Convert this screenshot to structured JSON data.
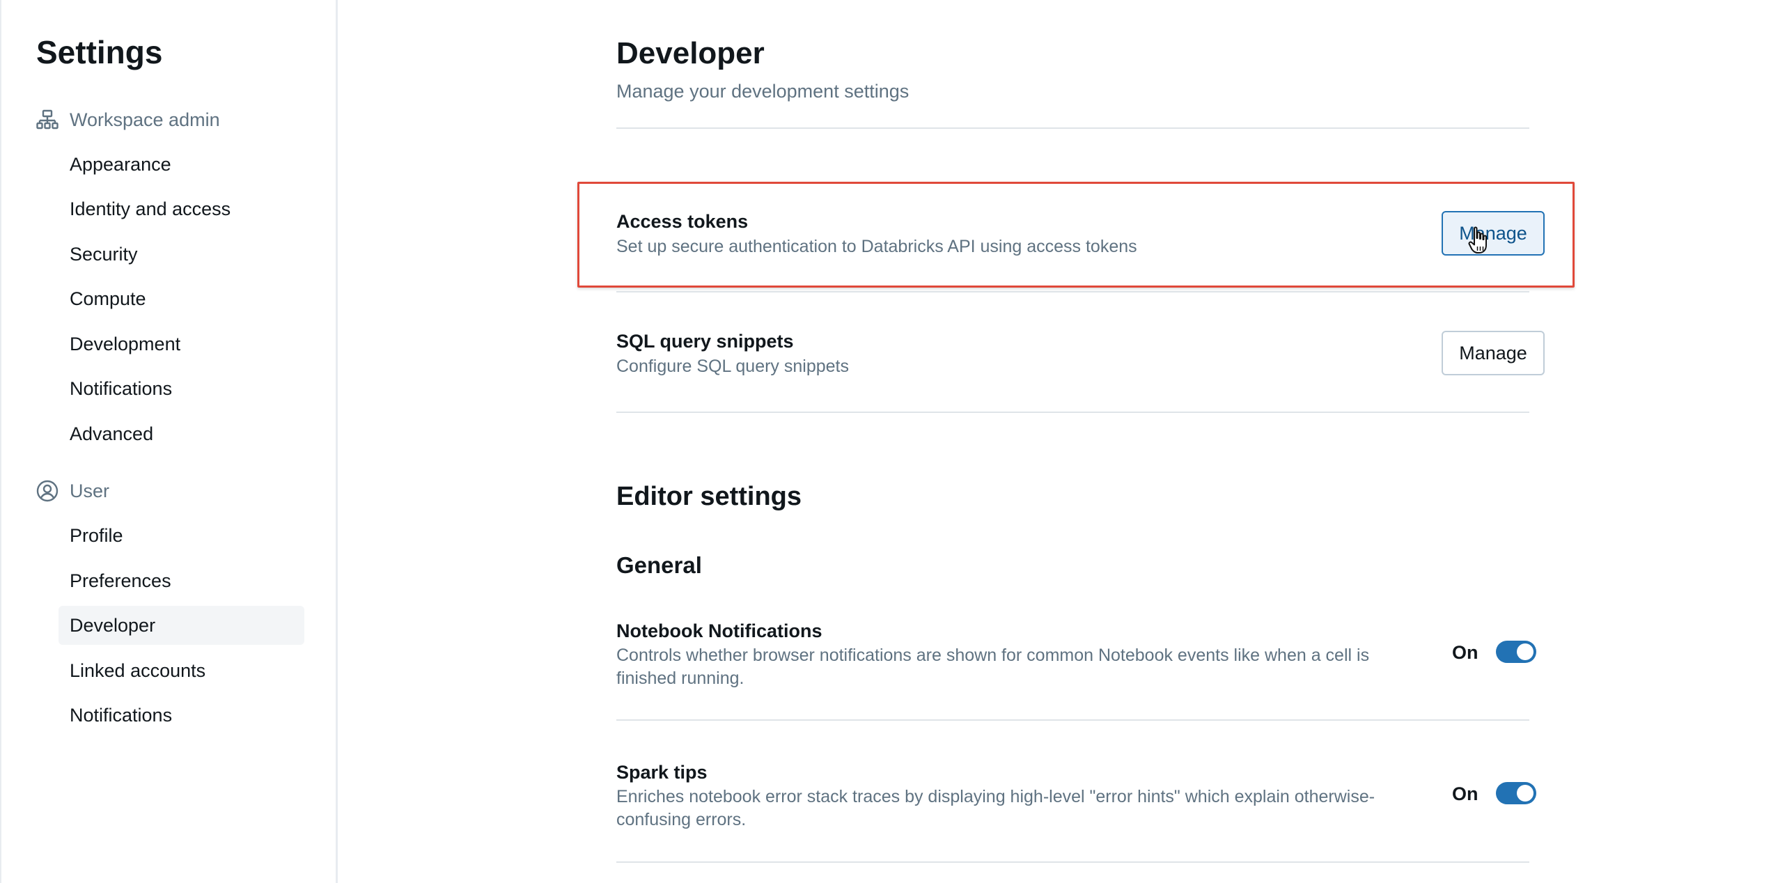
{
  "sidebar": {
    "title": "Settings",
    "groups": [
      {
        "label": "Workspace admin",
        "icon": "workspace-admin-icon",
        "items": [
          "Appearance",
          "Identity and access",
          "Security",
          "Compute",
          "Development",
          "Notifications",
          "Advanced"
        ]
      },
      {
        "label": "User",
        "icon": "user-circle-icon",
        "items": [
          "Profile",
          "Preferences",
          "Developer",
          "Linked accounts",
          "Notifications"
        ]
      }
    ],
    "active_item": "Developer"
  },
  "main": {
    "title": "Developer",
    "subtitle": "Manage your development settings",
    "rows": [
      {
        "title": "Access tokens",
        "description": "Set up secure authentication to Databricks API using access tokens",
        "button": "Manage"
      },
      {
        "title": "SQL query snippets",
        "description": "Configure SQL query snippets",
        "button": "Manage"
      }
    ],
    "editor_settings": {
      "title": "Editor settings",
      "subsection": "General",
      "toggles": [
        {
          "title": "Notebook Notifications",
          "description": "Controls whether browser notifications are shown for common Notebook events like when a cell is finished running.",
          "state_label": "On",
          "on": true
        },
        {
          "title": "Spark tips",
          "description": "Enriches notebook error stack traces by displaying high-level \"error hints\" which explain otherwise-confusing errors.",
          "state_label": "On",
          "on": true
        }
      ]
    }
  },
  "colors": {
    "accent": "#2272b4",
    "highlight_border": "#e0493a",
    "muted_text": "#5f7281"
  }
}
